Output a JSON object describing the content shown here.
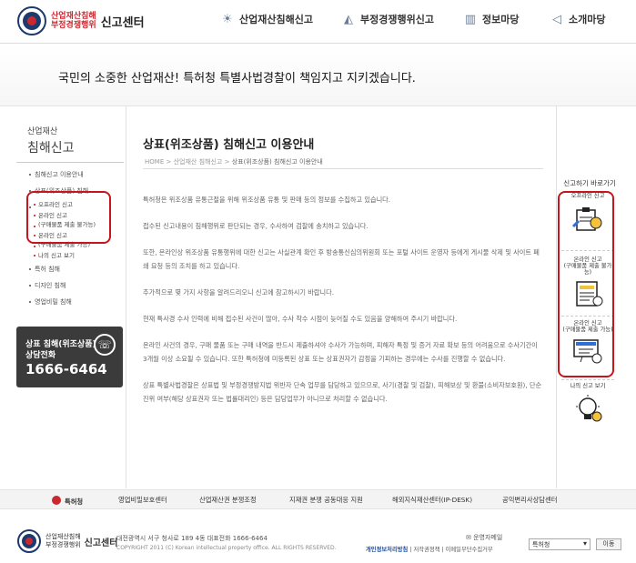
{
  "header": {
    "logo_line1": "산업재산침해",
    "logo_line2": "부정경쟁행위",
    "logo_big": "신고센터",
    "nav": [
      {
        "label": "산업재산침해신고",
        "icon": "megaphone-icon"
      },
      {
        "label": "부정경쟁행위신고",
        "icon": "monitor-icon"
      },
      {
        "label": "정보마당",
        "icon": "building-icon"
      },
      {
        "label": "소개마당",
        "icon": "speaker-icon"
      }
    ]
  },
  "banner": {
    "text": "국민의 소중한 산업재산! 특허청 특별사법경찰이 책임지고 지키겠습니다."
  },
  "sidebar": {
    "small_title": "산업재산",
    "big_title": "침해신고",
    "items": [
      "침해신고 이용안내",
      "상표(위조상품) 침해",
      "특허 침해",
      "디자인 침해",
      "영업비밀 침해"
    ],
    "subitems": [
      "오프라인 신고",
      "온라인 신고",
      "(구매물품 제출 불가능)",
      "온라인 신고",
      "(구매물품 제출 가능)",
      "나의 신고 보기"
    ],
    "call": {
      "line1": "상표 침해(위조상품)",
      "line2": "상담전화",
      "number": "1666-6464"
    }
  },
  "main": {
    "title": "상표(위조상품) 침해신고 이용안내",
    "breadcrumb": {
      "home": "HOME",
      "sep": ">",
      "level1": "산업재산 침해신고",
      "current": "상표(위조상품) 침해신고 이용안내"
    },
    "paragraphs": [
      "특허청은 위조상품 유통근절을 위해 위조상품 유통 및 판매 등의 정보를 수집하고 있습니다.",
      "접수된 신고내용이 침해행위로 판단되는 경우, 수사하여 검찰에 송치하고 있습니다.",
      "또한, 온라인상 위조상품 유통행위에 대한 신고는 사실관계 확인 후 방송통신심의위원회 또는 포털 사이트 운영자 등에게 게시물 삭제 및 사이트 폐쇄 요청 등의 조치를 하고 있습니다.",
      "추가적으로 몇 가지 사항을 알려드리오니 신고에 참고하시기 바랍니다.",
      "현재 특사경 수사 인력에 비해 접수된 사건이 많아, 수사 착수 시점이 늦어질 수도 있음을 양해하여 주시기 바랍니다.",
      "온라인 사건의 경우, 구매 물품 또는 구매 내역을 반드시 제출하셔야 수사가 가능하며, 피해자 특정 및 증거 자료 확보 등의 어려움으로 수사기간이 3개월 이상 소요될 수 있습니다. 또한 특허청에 미등록된 상표 또는 상표권자가 감정을 기피하는 경우에는 수사를 진행할 수 없습니다.",
      "상표 특별사법경찰은 상표법 및 부정경쟁방지법 위반자 단속 업무를 담당하고 있으므로, 사기(경찰 및 검찰), 피해보상 및 환불(소비자보호원), 단순 진위 여부(해당 상표권자 또는 법률대리인) 등은 담당업무가 아니므로 처리할 수 없습니다."
    ]
  },
  "shortcuts": {
    "heading": "신고하기 바로가기",
    "items": [
      {
        "label1": "오프라인 신고",
        "label2": ""
      },
      {
        "label1": "온라인 신고",
        "label2": "(구매물품 제출 불가능)"
      },
      {
        "label1": "온라인 신고",
        "label2": "(구매물품 제출 가능)"
      },
      {
        "label1": "나의 신고 보기",
        "label2": ""
      }
    ]
  },
  "footer_links": [
    "특허청",
    "영업비밀보호센터",
    "산업재산권 분쟁조정",
    "지재권 분쟁 공동대응 지원",
    "해외지식재산센터(IP-DESK)",
    "공익변리사상담센터"
  ],
  "footer": {
    "logo_line1": "산업재산침해",
    "logo_line2": "부정경쟁행위",
    "logo_big": "신고센터",
    "address": "대전광역시 서구 청사로 189 4동 대표전화 1666-6464",
    "copyright": "COPYRIGHT 2011 (C) Korean intellectual property office. ALL RIGHTS RESERVED.",
    "mail": "운영자메일",
    "policy1": "개인정보처리방침",
    "policy2": "저작권정책",
    "policy3": "이메일무단수집거부",
    "select_value": "특허청",
    "go_button": "이동"
  }
}
